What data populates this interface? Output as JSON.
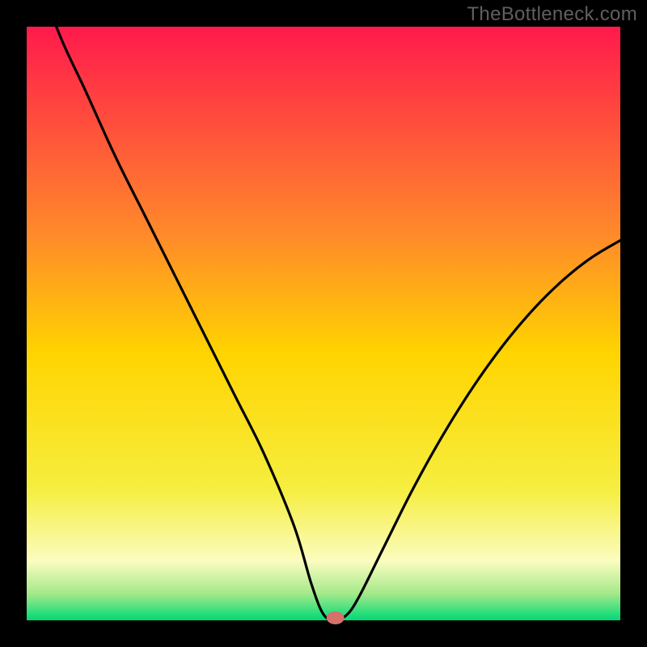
{
  "attribution": "TheBottleneck.com",
  "colors": {
    "top": "#ff1a4c",
    "mid_upper": "#ff8a2a",
    "mid": "#ffd400",
    "mid_lower": "#f6ee40",
    "pale": "#fbfcc0",
    "green_light": "#a4e98a",
    "green": "#00d976",
    "marker": "#d6706b",
    "curve": "#000000",
    "frame": "#000000"
  },
  "plot": {
    "inner_x": 33,
    "inner_y": 33,
    "inner_w": 734,
    "inner_h": 734
  },
  "chart_data": {
    "type": "line",
    "title": "",
    "xlabel": "",
    "ylabel": "",
    "xlim": [
      0,
      100
    ],
    "ylim": [
      0,
      100
    ],
    "x": [
      0,
      5,
      10,
      15,
      20,
      25,
      30,
      35,
      40,
      45,
      48,
      50,
      52,
      54,
      56,
      60,
      65,
      70,
      75,
      80,
      85,
      90,
      95,
      100
    ],
    "values": [
      115,
      100,
      89,
      78,
      68,
      58,
      48,
      38,
      28,
      16,
      6,
      1,
      0,
      1,
      4,
      12,
      22,
      31,
      39,
      46,
      52,
      57,
      61,
      64
    ],
    "optimum_x": 52,
    "optimum_y": 0,
    "gradient_stops": [
      {
        "pos": 0.0,
        "key": "top"
      },
      {
        "pos": 0.35,
        "key": "mid_upper"
      },
      {
        "pos": 0.55,
        "key": "mid"
      },
      {
        "pos": 0.78,
        "key": "mid_lower"
      },
      {
        "pos": 0.9,
        "key": "pale"
      },
      {
        "pos": 0.955,
        "key": "green_light"
      },
      {
        "pos": 1.0,
        "key": "green"
      }
    ]
  }
}
